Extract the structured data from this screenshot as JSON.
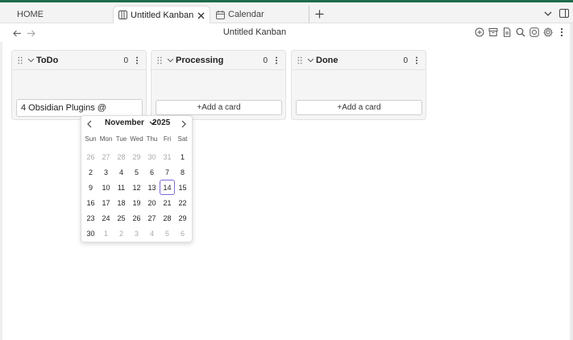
{
  "tabs": {
    "home": "HOME",
    "active": "Untitled Kanban",
    "calendar": "Calendar"
  },
  "header": {
    "title": "Untitled Kanban"
  },
  "lanes": [
    {
      "title": "ToDo",
      "count": "0",
      "input_value": "4 Obsidian Plugins @"
    },
    {
      "title": "Processing",
      "count": "0",
      "add_label": "+Add a card"
    },
    {
      "title": "Done",
      "count": "0",
      "add_label": "+Add a card"
    }
  ],
  "picker": {
    "month": "November",
    "year": "2025",
    "weekdays": [
      "Sun",
      "Mon",
      "Tue",
      "Wed",
      "Thu",
      "Fri",
      "Sat"
    ],
    "days": [
      {
        "d": "26",
        "m": true
      },
      {
        "d": "27",
        "m": true
      },
      {
        "d": "28",
        "m": true
      },
      {
        "d": "29",
        "m": true
      },
      {
        "d": "30",
        "m": true
      },
      {
        "d": "31",
        "m": true
      },
      {
        "d": "1"
      },
      {
        "d": "2"
      },
      {
        "d": "3"
      },
      {
        "d": "4"
      },
      {
        "d": "5"
      },
      {
        "d": "6"
      },
      {
        "d": "7"
      },
      {
        "d": "8"
      },
      {
        "d": "9"
      },
      {
        "d": "10"
      },
      {
        "d": "11"
      },
      {
        "d": "12"
      },
      {
        "d": "13"
      },
      {
        "d": "14",
        "today": true
      },
      {
        "d": "15"
      },
      {
        "d": "16"
      },
      {
        "d": "17"
      },
      {
        "d": "18"
      },
      {
        "d": "19"
      },
      {
        "d": "20"
      },
      {
        "d": "21"
      },
      {
        "d": "22"
      },
      {
        "d": "23"
      },
      {
        "d": "24"
      },
      {
        "d": "25"
      },
      {
        "d": "26"
      },
      {
        "d": "27"
      },
      {
        "d": "28"
      },
      {
        "d": "29"
      },
      {
        "d": "30"
      },
      {
        "d": "1",
        "m": true
      },
      {
        "d": "2",
        "m": true
      },
      {
        "d": "3",
        "m": true
      },
      {
        "d": "4",
        "m": true
      },
      {
        "d": "5",
        "m": true
      },
      {
        "d": "6",
        "m": true
      }
    ]
  },
  "icons": {
    "tab_kanban": "kanban-icon",
    "tab_calendar": "calendar-icon",
    "close": "close-icon",
    "add": "plus-icon",
    "chevron": "chevron-down-icon"
  },
  "colors": {
    "accent": "#7b6cd9",
    "topstrip": "#1e6b4b"
  }
}
